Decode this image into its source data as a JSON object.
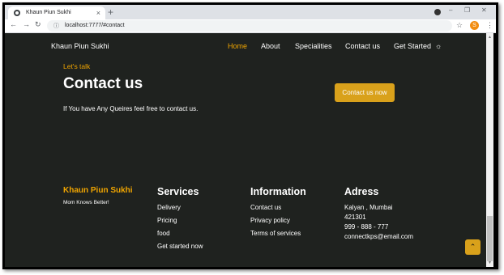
{
  "browser": {
    "tab_title": "Khaun Piun Sukhi",
    "tab_close_icon": "×",
    "new_tab_icon": "+",
    "window_controls": [
      "–",
      "❐",
      "✕"
    ],
    "url": "localhost:7777/#contact",
    "profile_initial": "S"
  },
  "nav": {
    "brand": "Khaun Piun Sukhi",
    "links": [
      "Home",
      "About",
      "Specialities",
      "Contact us",
      "Get Started"
    ],
    "active_link": "Home",
    "theme_icon": "☼"
  },
  "contact": {
    "eyebrow": "Let's talk",
    "title": "Contact us",
    "text": "If You have Any Queires feel free to contact us.",
    "button": "Contact us now"
  },
  "footer": {
    "brand": "Khaun Piun Sukhi",
    "tagline": "Mom Knows Better!",
    "services": {
      "heading": "Services",
      "items": [
        "Delivery",
        "Pricing",
        "food",
        "Get started now"
      ]
    },
    "information": {
      "heading": "Information",
      "items": [
        "Contact us",
        "Privacy policy",
        "Terms of services"
      ]
    },
    "address": {
      "heading": "Adress",
      "lines": [
        "Kalyan , Mumbai",
        "421301",
        "999 - 888 - 777",
        "connectkps@email.com"
      ]
    }
  },
  "back_to_top_icon": "⌃",
  "colors": {
    "page_bg": "#1f221f",
    "accent": "#f0a500",
    "button": "#d9a11b"
  }
}
